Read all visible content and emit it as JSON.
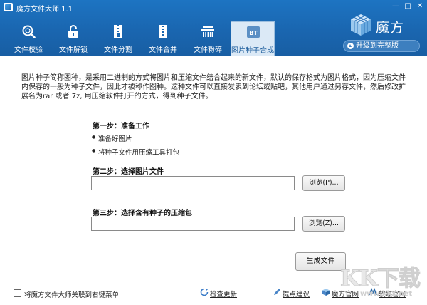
{
  "window": {
    "title": "魔方文件大师 1.1",
    "min_glyph": "—",
    "max_glyph": "□",
    "close_glyph": "✕"
  },
  "tabs": [
    {
      "label": "文件校验",
      "icon": "magnifier-icon"
    },
    {
      "label": "文件解锁",
      "icon": "unlock-icon"
    },
    {
      "label": "文件分割",
      "icon": "zipper-split-icon"
    },
    {
      "label": "文件合并",
      "icon": "zipper-merge-icon"
    },
    {
      "label": "文件粉碎",
      "icon": "shredder-icon"
    },
    {
      "label": "图片种子合成",
      "icon": "bt-icon",
      "icon_text": "BT",
      "active": true
    }
  ],
  "brand": {
    "name": "魔方",
    "upgrade_label": "升级到完整版"
  },
  "description": "图片种子简称图种，是采用二进制的方式将图片和压缩文件结合起来的新文件，默认的保存格式为图片格式，因为压缩文件内保存的一般为种子文件，因此才被称作图种。这种文件可以直接发表到论坛或贴吧，其他用户通过另存文件，然后修改扩展名为rar 或者 7z, 用压缩软件打开的方式，得到种子文件。",
  "step1": {
    "title": "第一步：准备工作",
    "bullets": [
      "准备好图片",
      "将种子文件用压缩工具打包"
    ]
  },
  "step2": {
    "title": "第二步：选择图片文件",
    "value": "",
    "browse_label": "浏览(P)..."
  },
  "step3": {
    "title": "第三步：选择含有种子的压缩包",
    "value": "",
    "browse_label": "浏览(Z)..."
  },
  "generate_label": "生成文件",
  "footer": {
    "context_menu_label": "将魔方文件大师关联到右键菜单",
    "check_update": "检查更新",
    "feedback": "提点建议",
    "website": "魔方官网",
    "ruanmei": "软媒官网"
  },
  "watermark": {
    "text": "KK下载",
    "url": "www.kkx.net"
  },
  "colors": {
    "header_blue": "#1a66b0",
    "active_tab_bg": "#dbe9f6"
  }
}
